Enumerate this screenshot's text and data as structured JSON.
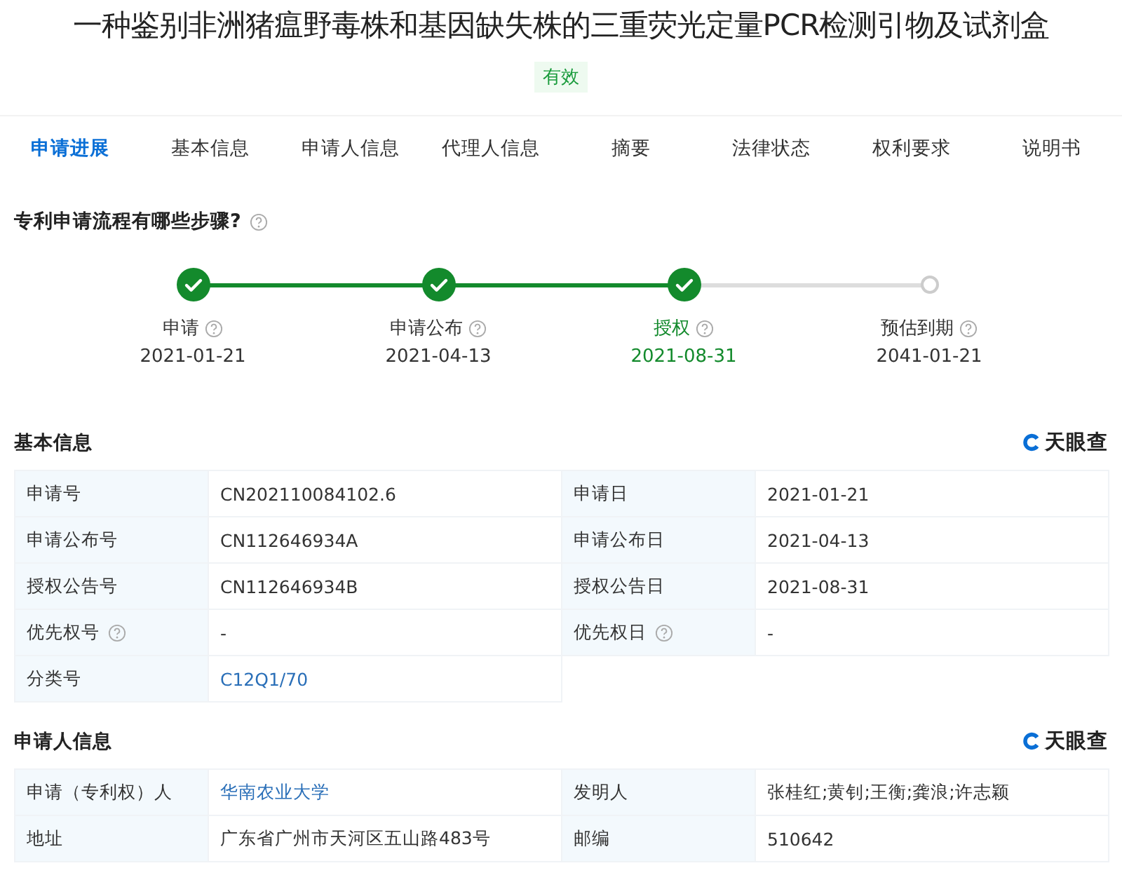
{
  "title": "一种鉴别非洲猪瘟野毒株和基因缺失株的三重荧光定量PCR检测引物及试剂盒",
  "status_badge": "有效",
  "tabs": [
    {
      "label": "申请进展",
      "selected": true
    },
    {
      "label": "基本信息",
      "selected": false
    },
    {
      "label": "申请人信息",
      "selected": false
    },
    {
      "label": "代理人信息",
      "selected": false
    },
    {
      "label": "摘要",
      "selected": false
    },
    {
      "label": "法律状态",
      "selected": false
    },
    {
      "label": "权利要求",
      "selected": false
    },
    {
      "label": "说明书",
      "selected": false
    }
  ],
  "process": {
    "question": "专利申请流程有哪些步骤?",
    "steps": [
      {
        "label": "申请",
        "date": "2021-01-21",
        "done": true,
        "current": false
      },
      {
        "label": "申请公布",
        "date": "2021-04-13",
        "done": true,
        "current": false
      },
      {
        "label": "授权",
        "date": "2021-08-31",
        "done": true,
        "current": true
      },
      {
        "label": "预估到期",
        "date": "2041-01-21",
        "done": false,
        "current": false
      }
    ]
  },
  "sections": [
    {
      "title": "基本信息",
      "logo": "天眼查",
      "rows": [
        [
          {
            "label": "申请号",
            "help": false,
            "value": "CN202110084102.6",
            "link": false
          },
          {
            "label": "申请日",
            "help": false,
            "value": "2021-01-21",
            "link": false
          }
        ],
        [
          {
            "label": "申请公布号",
            "help": false,
            "value": "CN112646934A",
            "link": false
          },
          {
            "label": "申请公布日",
            "help": false,
            "value": "2021-04-13",
            "link": false
          }
        ],
        [
          {
            "label": "授权公告号",
            "help": false,
            "value": "CN112646934B",
            "link": false
          },
          {
            "label": "授权公告日",
            "help": false,
            "value": "2021-08-31",
            "link": false
          }
        ],
        [
          {
            "label": "优先权号",
            "help": true,
            "value": "-",
            "link": false
          },
          {
            "label": "优先权日",
            "help": true,
            "value": "-",
            "link": false
          }
        ],
        [
          {
            "label": "分类号",
            "help": false,
            "value": "C12Q1/70",
            "link": true
          }
        ]
      ]
    },
    {
      "title": "申请人信息",
      "logo": "天眼查",
      "rows": [
        [
          {
            "label": "申请（专利权）人",
            "help": false,
            "value": "华南农业大学",
            "link": true
          },
          {
            "label": "发明人",
            "help": false,
            "value": "张桂红;黄钊;王衡;龚浪;许志颖",
            "link": false
          }
        ],
        [
          {
            "label": "地址",
            "help": false,
            "value": "广东省广州市天河区五山路483号",
            "link": false
          },
          {
            "label": "邮编",
            "help": false,
            "value": "510642",
            "link": false
          }
        ]
      ]
    }
  ]
}
